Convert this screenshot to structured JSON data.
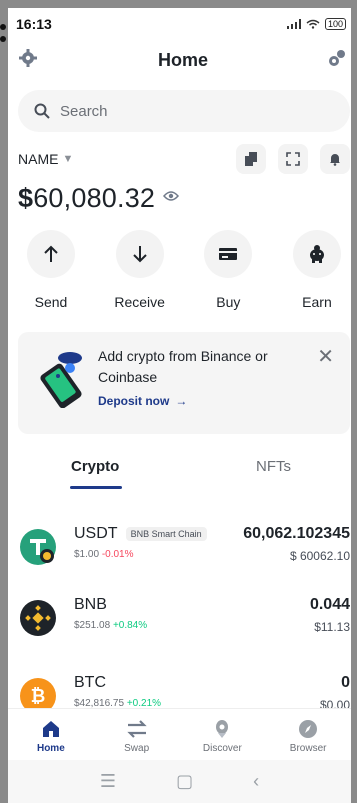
{
  "status_bar": {
    "time": "16:13",
    "battery": "100"
  },
  "header": {
    "title": "Home"
  },
  "search": {
    "placeholder": "Search"
  },
  "wallet": {
    "name": "NAME"
  },
  "balance": {
    "currency": "$",
    "value": "60,080.32"
  },
  "actions": [
    {
      "label": "Send",
      "icon": "arrow-up-icon"
    },
    {
      "label": "Receive",
      "icon": "arrow-down-icon"
    },
    {
      "label": "Buy",
      "icon": "card-icon"
    },
    {
      "label": "Earn",
      "icon": "piggy-icon"
    }
  ],
  "promo": {
    "text": "Add crypto from Binance or Coinbase",
    "link": "Deposit now",
    "link_arrow": "→"
  },
  "tabs": [
    {
      "label": "Crypto",
      "active": true
    },
    {
      "label": "NFTs",
      "active": false
    }
  ],
  "assets": [
    {
      "symbol": "USDT",
      "chain": "BNB Smart Chain",
      "price": "$1.00",
      "change": "-0.01%",
      "change_dir": "down",
      "amount": "60,062.102345",
      "fiat": "$ 60062.10",
      "color": "#26a17b"
    },
    {
      "symbol": "BNB",
      "chain": "",
      "price": "$251.08",
      "change": "+0.84%",
      "change_dir": "up",
      "amount": "0.044",
      "fiat": "$11.13",
      "color": "#1e2329"
    },
    {
      "symbol": "BTC",
      "chain": "",
      "price": "$42,816.75",
      "change": "+0.21%",
      "change_dir": "up",
      "amount": "0",
      "fiat": "$0.00",
      "color": "#f7931a"
    }
  ],
  "bottom_nav": [
    {
      "label": "Home",
      "active": true
    },
    {
      "label": "Swap",
      "active": false
    },
    {
      "label": "Discover",
      "active": false
    },
    {
      "label": "Browser",
      "active": false
    }
  ],
  "colors": {
    "accent": "#1e3a8a",
    "negative": "#f6465d",
    "positive": "#0ecb81"
  }
}
